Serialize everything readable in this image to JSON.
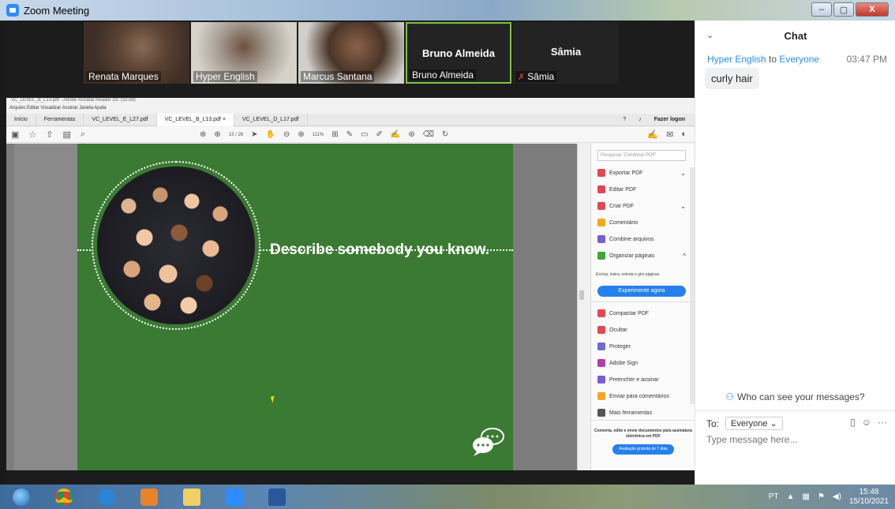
{
  "window": {
    "title": "Zoom Meeting",
    "controls": [
      "–",
      "▢",
      "X"
    ]
  },
  "participants": [
    {
      "name": "Renata Marques",
      "video": true
    },
    {
      "name": "Hyper English",
      "video": true
    },
    {
      "name": "Marcus Santana",
      "video": true
    },
    {
      "name": "Bruno Almeida",
      "video": false,
      "display": "Bruno Almeida",
      "active_speaker": true
    },
    {
      "name": "Sâmia",
      "video": false,
      "display": "Sâmia",
      "muted": true
    }
  ],
  "acrobat": {
    "window_title": "VC_LEVEL_B_L13.pdf - Adobe Acrobat Reader DC (32-bit)",
    "menu": "Arquivo  Editar  Visualizar  Assinar  Janela  Ajuda",
    "tabs": [
      "Início",
      "Ferramentas",
      "VC_LEVEL_E_L27.pdf",
      "VC_LEVEL_B_L13.pdf ×",
      "VC_LEVEL_D_L17.pdf"
    ],
    "login": "Fazer logon",
    "page_indicator": "13 / 26",
    "zoom": "111%",
    "search_placeholder": "Pesquisar 'Combinar PDF'",
    "tools": [
      {
        "label": "Exportar PDF",
        "color": "#e34850",
        "chev": "⌄"
      },
      {
        "label": "Editar PDF",
        "color": "#e34850",
        "chev": ""
      },
      {
        "label": "Criar PDF",
        "color": "#e34850",
        "chev": "⌄"
      },
      {
        "label": "Comentário",
        "color": "#f5a623",
        "chev": ""
      },
      {
        "label": "Combine arquivos",
        "color": "#7a5cd6",
        "chev": ""
      },
      {
        "label": "Organizar páginas",
        "color": "#3fa535",
        "chev": "^"
      }
    ],
    "organize_note": "Exclua, insira, extraia e gire páginas.",
    "try_button": "Experimente agora",
    "tools2": [
      {
        "label": "Compactar PDF",
        "color": "#e34850"
      },
      {
        "label": "Ocultar",
        "color": "#e34850"
      },
      {
        "label": "Proteger",
        "color": "#6f6bd6"
      },
      {
        "label": "Adobe Sign",
        "color": "#b23fa5"
      },
      {
        "label": "Preencher e assinar",
        "color": "#7a5cd6"
      },
      {
        "label": "Enviar para comentários",
        "color": "#f5a623"
      },
      {
        "label": "Mais ferramentas",
        "color": "#555555"
      }
    ],
    "promo_text": "Converta, edite e envie documentos para assinatura eletrônica em PDF",
    "promo_button": "Avaliação gratuita de 7 dias"
  },
  "slide": {
    "heading": "Describe somebody you know.",
    "background": "#3b7a33"
  },
  "chat": {
    "title": "Chat",
    "messages": [
      {
        "from": "Hyper English",
        "to_word": "to",
        "to": "Everyone",
        "time": "03:47 PM",
        "text": "curly hair"
      }
    ],
    "who_can_see": "Who can see your messages?",
    "to_label": "To:",
    "recipient": "Everyone ⌄",
    "placeholder": "Type message here...",
    "accent": "#2d8cff"
  },
  "taskbar": {
    "language": "PT",
    "time": "15:48",
    "date": "15/10/2021"
  }
}
